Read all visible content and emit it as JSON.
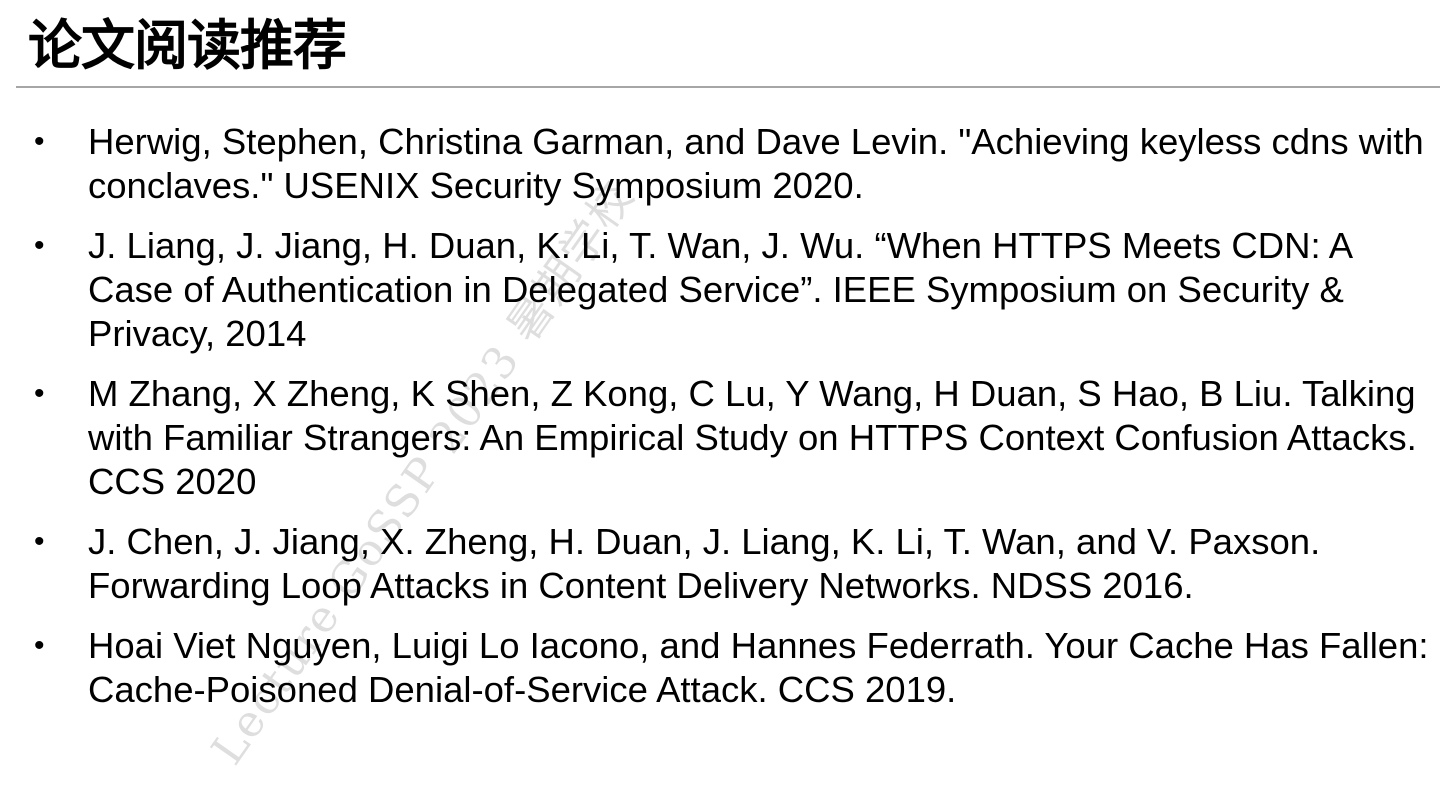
{
  "slide": {
    "title": "论文阅读推荐"
  },
  "references": [
    {
      "bullet": "•",
      "text": "Herwig, Stephen, Christina Garman, and Dave Levin. \"Achieving keyless cdns with conclaves.\" USENIX Security Symposium 2020."
    },
    {
      "bullet": "•",
      "text": "J. Liang, J. Jiang, H. Duan, K. Li, T. Wan, J. Wu. “When HTTPS Meets CDN: A Case of Authentication in Delegated Service”. IEEE Symposium on Security & Privacy, 2014"
    },
    {
      "bullet": "•",
      "text": "M Zhang, X Zheng, K Shen, Z Kong, C Lu, Y Wang, H Duan, S Hao, B Liu. Talking with Familiar Strangers: An Empirical Study on HTTPS Context Confusion Attacks. CCS 2020"
    },
    {
      "bullet": "•",
      "text": "J. Chen, J. Jiang, X. Zheng, H. Duan, J. Liang, K. Li, T. Wan, and V. Paxson. Forwarding Loop Attacks in Content Delivery Networks.  NDSS 2016."
    },
    {
      "bullet": "•",
      "text": "Hoai Viet Nguyen, Luigi Lo Iacono, and Hannes Federrath. Your Cache Has Fallen: Cache-Poisoned Denial-of-Service Attack. CCS 2019."
    }
  ],
  "watermark": {
    "text": "Lecture GoSSP 2023 暑期学校"
  }
}
